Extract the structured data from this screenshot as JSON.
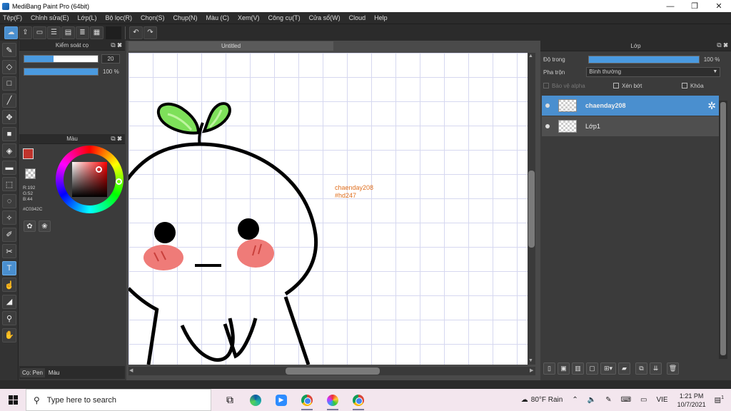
{
  "window": {
    "title": "MediBang Paint Pro (64bit)",
    "minimize": "—",
    "maximize": "❐",
    "close": "✕"
  },
  "menu": [
    "Tệp(F)",
    "Chỉnh sửa(E)",
    "Lớp(L)",
    "Bộ lọc(R)",
    "Chọn(S)",
    "Chụp(N)",
    "Màu (C)",
    "Xem(V)",
    "Công cụ(T)",
    "Cửa sổ(W)",
    "Cloud",
    "Help"
  ],
  "brush_panel": {
    "title": "Kiểm soát cọ",
    "size_value": "20",
    "size_fill": 0.4,
    "opacity_label": "100 %",
    "opacity_fill": 1.0
  },
  "color_panel": {
    "title": "Màu",
    "foreground": "#c0342c",
    "r": "R:192",
    "g": "G:52",
    "b": "B:44",
    "hex": "#C0342C"
  },
  "bottom_tabs": [
    "Cọ: Pen",
    "Màu"
  ],
  "document": {
    "tab": "Untitled",
    "annotation_line1": "chaenday208",
    "annotation_line2": "#hd247"
  },
  "layer_panel": {
    "title": "Lớp",
    "opacity_label": "Độ trong",
    "opacity_value": "100 %",
    "blend_label": "Pha trộn",
    "blend_value": "Bình thường",
    "protect_alpha": "Bảo vệ alpha",
    "clipping": "Xén bớt",
    "lock": "Khóa",
    "layers": [
      {
        "name": "chaenday208",
        "selected": true
      },
      {
        "name": "Lớp1",
        "selected": false
      }
    ]
  },
  "taskbar": {
    "search_placeholder": "Type here to search",
    "weather": "80°F  Rain",
    "language": "VIE",
    "time": "1:21 PM",
    "date": "10/7/2021",
    "notification_count": "1"
  },
  "colors": {
    "accent": "#4a9ae0",
    "layer_selected": "#4a8fcf",
    "annotation": "#e07020"
  }
}
